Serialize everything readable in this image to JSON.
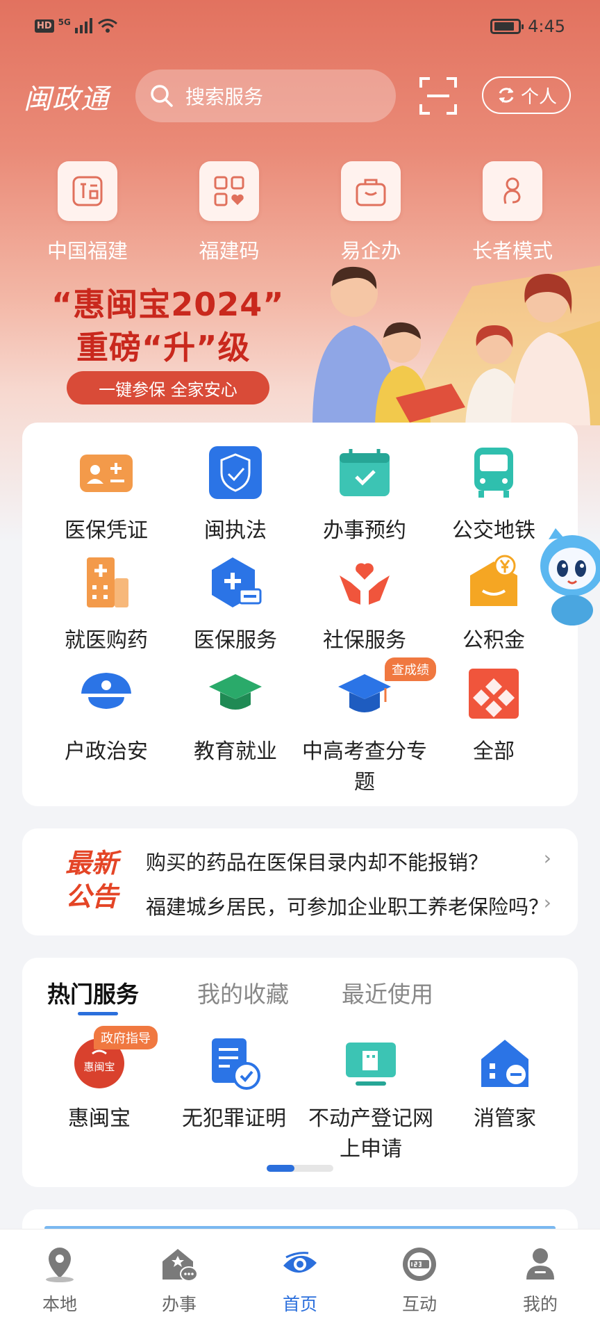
{
  "status_bar": {
    "hd": "HD",
    "network": "5G",
    "time": "4:45"
  },
  "header": {
    "logo": "闽政通",
    "search_placeholder": "搜索服务",
    "switch_label": "个人"
  },
  "quick_entries": [
    {
      "label": "中国福建",
      "icon": "fu-seal-icon"
    },
    {
      "label": "福建码",
      "icon": "qr-code-heart-icon"
    },
    {
      "label": "易企办",
      "icon": "briefcase-icon"
    },
    {
      "label": "长者模式",
      "icon": "elder-icon"
    }
  ],
  "banner": {
    "title_line1": "“惠闽宝2024”",
    "title_line2": "重磅“升”级",
    "pill": "一键参保  全家安心"
  },
  "services": [
    {
      "label": "医保凭证",
      "icon": "id-card-icon",
      "color": "#f39a4a"
    },
    {
      "label": "闽执法",
      "icon": "shield-badge-icon",
      "color": "#2b74e6"
    },
    {
      "label": "办事预约",
      "icon": "calendar-check-icon",
      "color": "#3cc4b4"
    },
    {
      "label": "公交地铁",
      "icon": "bus-icon",
      "color": "#2fbfae"
    },
    {
      "label": "就医购药",
      "icon": "hospital-icon",
      "color": "#f39a4a"
    },
    {
      "label": "医保服务",
      "icon": "medical-card-icon",
      "color": "#2b74e6"
    },
    {
      "label": "社保服务",
      "icon": "hands-heart-icon",
      "color": "#f0553c"
    },
    {
      "label": "公积金",
      "icon": "envelope-yuan-icon",
      "color": "#f5a623"
    },
    {
      "label": "户政治安",
      "icon": "police-cap-icon",
      "color": "#2b74e6"
    },
    {
      "label": "教育就业",
      "icon": "graduation-cap-icon",
      "color": "#2aaa6a"
    },
    {
      "label": "中高考查分专题",
      "icon": "exam-cap-icon",
      "color": "#2b74e6"
    },
    {
      "label": "全部",
      "icon": "all-grid-icon",
      "color": "#f0553c"
    }
  ],
  "exam_badge": "查成绩",
  "notice": {
    "logo_line1": "最新",
    "logo_line2": "公告",
    "items": [
      "购买的药品在医保目录内却不能报销？",
      "福建城乡居民，可参加企业职工养老保险吗？"
    ]
  },
  "hot_services": {
    "tabs": [
      "热门服务",
      "我的收藏",
      "最近使用"
    ],
    "active_tab": 0,
    "items": [
      {
        "label": "惠闽宝",
        "icon": "huiminbao-logo-icon"
      },
      {
        "label": "无犯罪证明",
        "icon": "certificate-icon"
      },
      {
        "label": "不动产登记网上申请",
        "icon": "property-register-icon"
      },
      {
        "label": "消管家",
        "icon": "fire-house-icon"
      }
    ],
    "gov_badge": "政府指导",
    "logo_text": "惠闽宝"
  },
  "bottom_nav": [
    {
      "label": "本地",
      "icon": "location-pin-icon"
    },
    {
      "label": "办事",
      "icon": "office-chat-icon"
    },
    {
      "label": "首页",
      "icon": "eye-logo-icon"
    },
    {
      "label": "互动",
      "icon": "hotline-12345-icon"
    },
    {
      "label": "我的",
      "icon": "user-icon"
    }
  ],
  "active_nav": 2,
  "colors": {
    "accent": "#2b6fdc",
    "brand_red": "#e2725f",
    "banner_red": "#c9281d",
    "badge_orange": "#f07840"
  }
}
